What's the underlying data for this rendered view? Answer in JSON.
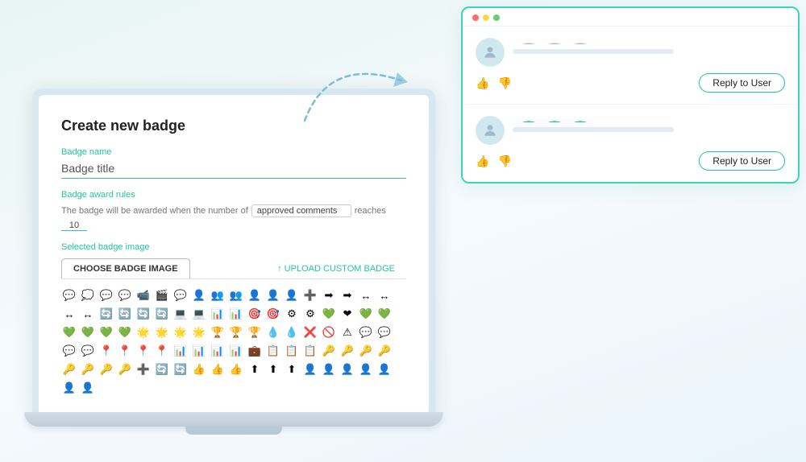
{
  "scene": {
    "background_color": "#eaf4f1"
  },
  "laptop": {
    "form": {
      "title": "Create new badge",
      "badge_name_label": "Badge name",
      "badge_name_placeholder": "Badge title",
      "badge_name_value": "Badge title",
      "award_rules_label": "Badge award rules",
      "award_rules_text": "The badge will be awarded when the number of",
      "award_rules_dropdown_value": "approved comments",
      "award_rules_reaches": "reaches",
      "award_rules_number": "10",
      "selected_badge_label": "Selected badge image",
      "tab_choose": "CHOOSE BADGE IMAGE",
      "tab_upload": "↑ UPLOAD CUSTOM BADGE"
    }
  },
  "panel": {
    "dots": [
      "red",
      "yellow",
      "green"
    ],
    "comments": [
      {
        "id": 1,
        "squiggle_color": "#b0c0cc",
        "reply_label": "Reply to User"
      },
      {
        "id": 2,
        "squiggle_color": "#22c7a0",
        "reply_label": "Reply to User"
      }
    ]
  },
  "icons": [
    "💬",
    "💬",
    "💬",
    "💬",
    "📹",
    "🎬",
    "💬",
    "👤",
    "👥",
    "👥",
    "👤",
    "👤",
    "👤",
    "👤",
    "↔",
    "↔",
    "↔",
    "↔",
    "↔",
    "↔",
    "🔄",
    "🔄",
    "🔄",
    "🔄",
    "👤",
    "💻",
    "💻",
    "📊",
    "📊",
    "🎯",
    "🎯",
    "💚",
    "❤",
    "💚",
    "💚",
    "🌟",
    "🌟",
    "🌟",
    "🌟",
    "🏆",
    "🏆",
    "🏆",
    "💧",
    "💧",
    "❌",
    "🚫",
    "⚠",
    "💬",
    "💬",
    "💬",
    "💬",
    "📍",
    "📊",
    "📊",
    "📊",
    "📊",
    "💼",
    "📋",
    "📋",
    "📋",
    "🔑",
    "🔑",
    "🔑",
    "🔑",
    "➕",
    "🔄",
    "🔄",
    "⬆",
    "⬆",
    "⬆",
    "👤",
    "👤",
    "👤",
    "👤",
    "👤",
    "👤",
    "👤"
  ]
}
